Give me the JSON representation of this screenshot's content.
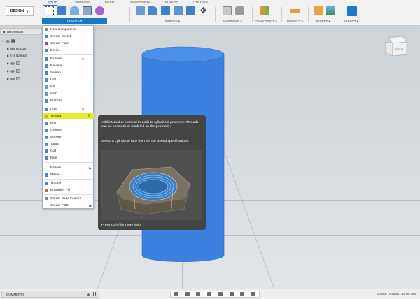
{
  "toolbar": {
    "workspace": "DESIGN",
    "tabs": [
      "SOLID",
      "SURFACE",
      "MESH",
      "SHEET METAL",
      "PLASTIC",
      "UTILITIES"
    ],
    "groups": {
      "create": "CREATE ▾",
      "modify": "MODIFY ▾",
      "assemble": "ASSEMBLE ▾",
      "construct": "CONSTRUCT ▾",
      "inspect": "INSPECT ▾",
      "insert": "INSERT ▾",
      "select": "SELECT ▾"
    }
  },
  "browser": {
    "title": "BROWSER",
    "rows": [
      "",
      "Docum",
      "Named",
      "",
      "",
      ""
    ]
  },
  "create_menu": {
    "items": [
      {
        "label": "New Component",
        "shortcut": "",
        "color": "#6d8fb0"
      },
      {
        "label": "Create Sketch",
        "shortcut": "",
        "color": "#3d8bd4"
      },
      {
        "label": "Create Form",
        "shortcut": "",
        "color": "#7c4db8"
      },
      {
        "label": "Derive",
        "shortcut": "",
        "color": "#5a7fa8"
      },
      {
        "label": "Extrude",
        "shortcut": "E",
        "color": "#4b86c9"
      },
      {
        "label": "Revolve",
        "shortcut": "",
        "color": "#4b86c9"
      },
      {
        "label": "Sweep",
        "shortcut": "",
        "color": "#4b86c9"
      },
      {
        "label": "Loft",
        "shortcut": "",
        "color": "#4b86c9"
      },
      {
        "label": "Rib",
        "shortcut": "",
        "color": "#6a9bd0"
      },
      {
        "label": "Web",
        "shortcut": "",
        "color": "#6a9bd0"
      },
      {
        "label": "Emboss",
        "shortcut": "",
        "color": "#4b86c9"
      },
      {
        "label": "Hole",
        "shortcut": "H",
        "color": "#4b86c9"
      },
      {
        "label": "Thread",
        "shortcut": "",
        "color": "#c9a84b"
      },
      {
        "label": "Box",
        "shortcut": "",
        "color": "#4b86c9"
      },
      {
        "label": "Cylinder",
        "shortcut": "",
        "color": "#4b86c9"
      },
      {
        "label": "Sphere",
        "shortcut": "",
        "color": "#4b86c9"
      },
      {
        "label": "Torus",
        "shortcut": "",
        "color": "#4b86c9"
      },
      {
        "label": "Coil",
        "shortcut": "",
        "color": "#4b86c9"
      },
      {
        "label": "Pipe",
        "shortcut": "",
        "color": "#4b86c9"
      },
      {
        "label": "Pattern",
        "shortcut": "",
        "color": "#4b86c9"
      },
      {
        "label": "Mirror",
        "shortcut": "",
        "color": "#4b86c9"
      },
      {
        "label": "Thicken",
        "shortcut": "",
        "color": "#4b86c9"
      },
      {
        "label": "Boundary Fill",
        "shortcut": "",
        "color": "#b76a3a"
      },
      {
        "label": "Create Base Feature",
        "shortcut": "",
        "color": "#888888"
      },
      {
        "label": "Create PCB",
        "shortcut": "",
        "color": "#3c9b4a"
      }
    ]
  },
  "tooltip": {
    "description": "Add internal or external threads to cylindrical geometry. Threads can be cosmetic or modeled on the geometry.",
    "instruction": "Select a cylindrical face then set the thread specifications.",
    "footer": "Press Ctrl+/ for more help."
  },
  "statusbar": {
    "comments": "COMMENTS",
    "info": "1 Face | Radius : 10.00 mm"
  },
  "colors": {
    "accent": "#1a7ac8",
    "highlight": "#e6ee2a",
    "cylinder": "#3b82e0"
  }
}
